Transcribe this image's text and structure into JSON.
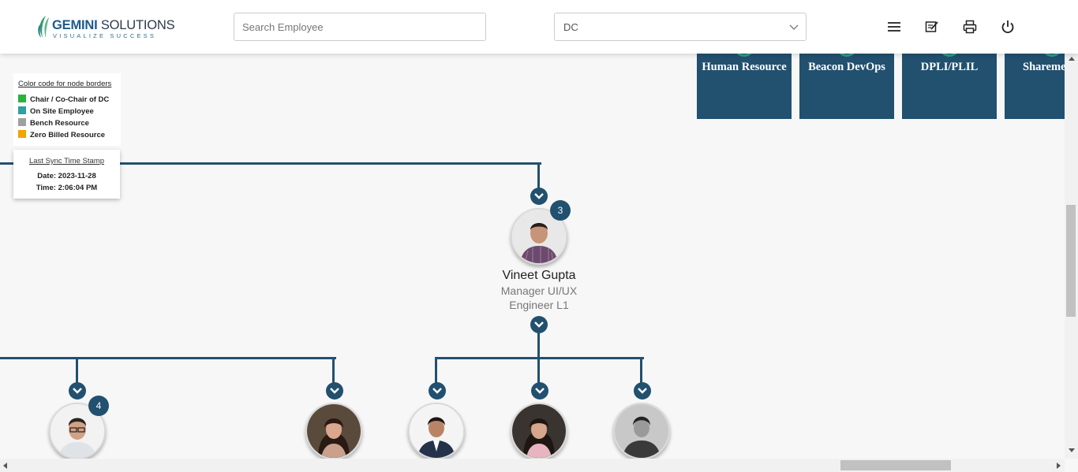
{
  "header": {
    "logo": {
      "name": "GEMINI SOLUTIONS",
      "name_bold": "GEMINI",
      "name_rest": " SOLUTIONS",
      "tagline": "VISUALIZE SUCCESS"
    },
    "search": {
      "placeholder": "Search Employee",
      "value": ""
    },
    "filter": {
      "selected": "DC"
    },
    "icons": [
      "menu-icon",
      "edit-note-icon",
      "print-icon",
      "power-icon"
    ]
  },
  "departments": [
    "Human Resource",
    "Beacon DevOps",
    "DPLI/PLIL",
    "Shareme"
  ],
  "legend": {
    "title": "Color code for node borders",
    "items": [
      {
        "label": "Chair / Co-Chair of DC",
        "color": "#28b43c"
      },
      {
        "label": "On Site Employee",
        "color": "#2e9fa2"
      },
      {
        "label": "Bench Resource",
        "color": "#a0a0a0"
      },
      {
        "label": "Zero Billed Resource",
        "color": "#f0a500"
      }
    ]
  },
  "sync": {
    "title": "Last Sync Time Stamp",
    "date": "Date: 2023-11-28",
    "time": "Time: 2:06:04 PM"
  },
  "manager": {
    "name": "Vineet Gupta",
    "title_line1": "Manager UI/UX",
    "title_line2": "Engineer L1",
    "reports_count": "3"
  },
  "children": [
    {
      "reports_count": "4"
    },
    {
      "reports_count": ""
    },
    {
      "reports_count": ""
    },
    {
      "reports_count": ""
    },
    {
      "reports_count": ""
    }
  ],
  "colors": {
    "node": "#22506f",
    "accent": "#2e9d8a"
  }
}
